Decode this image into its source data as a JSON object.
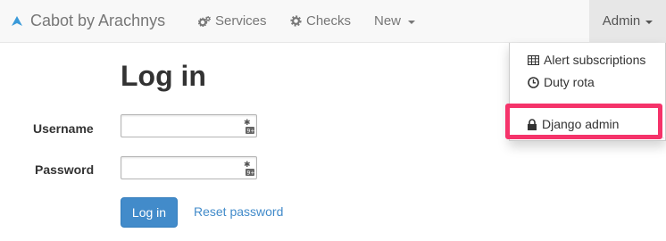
{
  "navbar": {
    "brand": "Cabot by Arachnys",
    "items": [
      {
        "label": "Services",
        "icon": "gears-icon"
      },
      {
        "label": "Checks",
        "icon": "gear-icon"
      },
      {
        "label": "New",
        "icon": "caret-down-icon"
      }
    ],
    "admin_label": "Admin"
  },
  "dropdown": {
    "items": [
      {
        "label": "Alert subscriptions",
        "icon": "table-icon"
      },
      {
        "label": "Duty rota",
        "icon": "clock-icon"
      },
      {
        "label": "Django admin",
        "icon": "lock-icon"
      }
    ]
  },
  "form": {
    "title": "Log in",
    "username_label": "Username",
    "password_label": "Password",
    "username_value": "",
    "password_value": "",
    "login_button": "Log in",
    "reset_link": "Reset password"
  },
  "colors": {
    "primary": "#428bca",
    "highlight": "#f5336a",
    "navbar_bg": "#f8f8f8"
  }
}
